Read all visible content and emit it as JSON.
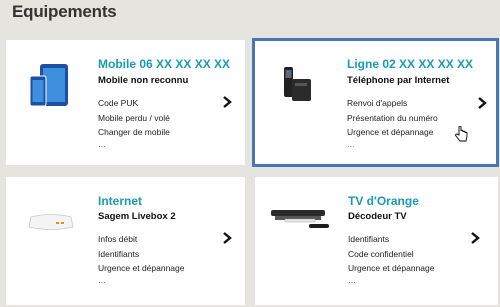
{
  "heading": "Equipements",
  "cards": [
    {
      "title": "Mobile 06 XX XX XX XX",
      "subtitle": "Mobile non reconnu",
      "links": [
        "Code PUK",
        "Mobile perdu / volé",
        "Changer de mobile"
      ],
      "more": "…",
      "icon": "mobile-tablet-icon"
    },
    {
      "title": "Ligne 02 XX XX XX XX",
      "subtitle": "Téléphone par Internet",
      "links": [
        "Renvoi d'appels",
        "Présentation du numéro",
        "Urgence et dépannage"
      ],
      "more": "…",
      "icon": "home-phone-icon"
    },
    {
      "title": "Internet",
      "subtitle": "Sagem Livebox 2",
      "links": [
        "Infos débit",
        "Identifiants",
        "Urgence et dépannage"
      ],
      "more": "…",
      "icon": "livebox-router-icon"
    },
    {
      "title": "TV d'Orange",
      "subtitle": "Décodeur TV",
      "links": [
        "Identifiants",
        "Code confidentiel",
        "Urgence et dépannage"
      ],
      "more": "…",
      "icon": "tv-decoder-icon"
    }
  ],
  "colors": {
    "accent": "#1a9cae",
    "selection_border": "#4a75b8",
    "background": "#e6e4df"
  }
}
